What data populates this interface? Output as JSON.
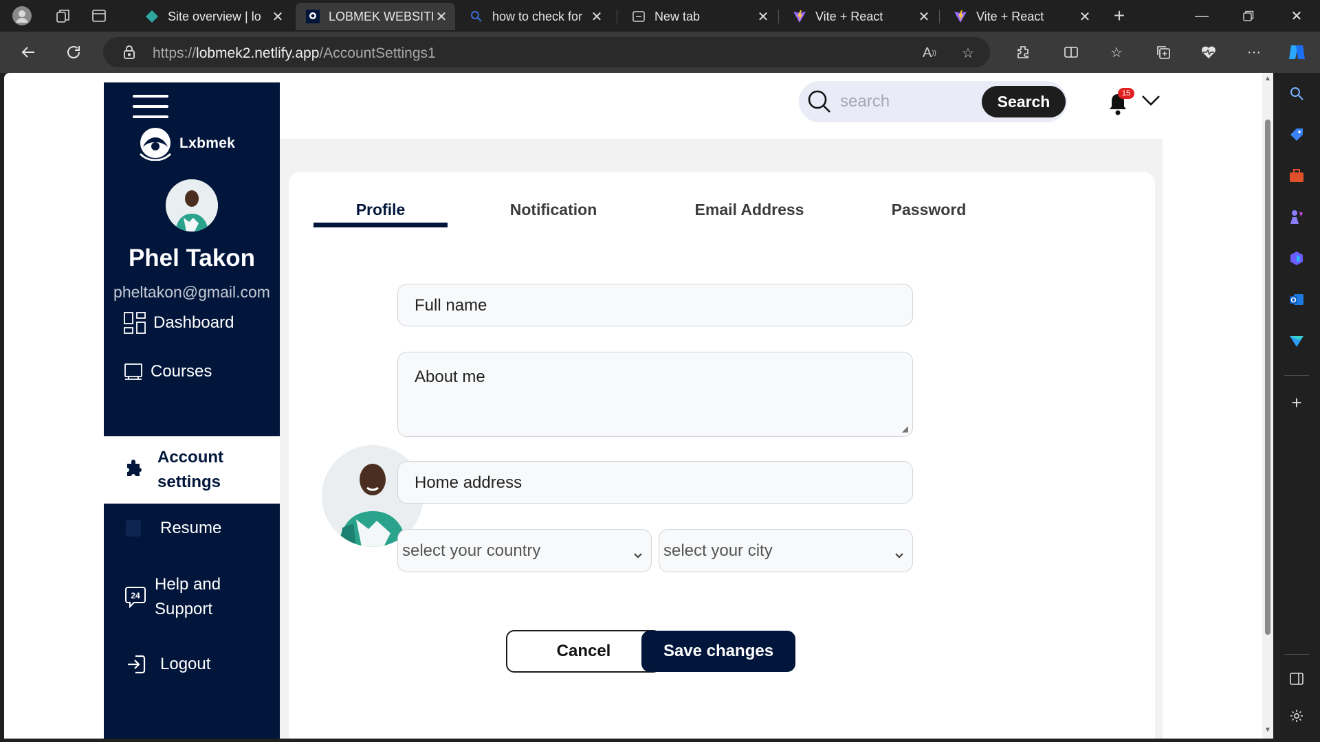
{
  "browser": {
    "tabs": [
      {
        "title": "Site overview | lo",
        "icon": "netlify-icon",
        "active": false
      },
      {
        "title": "LOBMEK WEBSITE",
        "icon": "lobmek-favicon",
        "active": true
      },
      {
        "title": "how to check for",
        "icon": "search-favicon",
        "active": false
      },
      {
        "title": "New tab",
        "icon": "new-tab-favicon",
        "active": false
      },
      {
        "title": "Vite + React",
        "icon": "vite-favicon",
        "active": false
      },
      {
        "title": "Vite + React",
        "icon": "vite-favicon",
        "active": false
      }
    ],
    "url_prefix": "https://",
    "url_host": "lobmek2.netlify.app",
    "url_path": "/AccountSettings1"
  },
  "sidebar": {
    "logo_text": "Lxbmek",
    "user_name": "Phel Takon",
    "user_email": "pheltakon@gmail.com",
    "items": [
      {
        "label": "Dashboard",
        "icon": "dashboard-icon"
      },
      {
        "label": "Courses",
        "icon": "courses-icon"
      },
      {
        "label": "Account settings",
        "icon": "puzzle-icon",
        "active": true
      },
      {
        "label": "Resume",
        "icon": "resume-icon"
      },
      {
        "label": "Help and Support",
        "icon": "support-24-icon"
      },
      {
        "label": "Logout",
        "icon": "logout-icon"
      }
    ]
  },
  "header": {
    "search_placeholder": "search",
    "search_button": "Search",
    "notification_count": "15"
  },
  "settings": {
    "tabs": [
      "Profile",
      "Notification",
      "Email Address",
      "Password"
    ],
    "active_tab": "Profile",
    "full_name_placeholder": "Full name",
    "about_placeholder": "About me",
    "address_placeholder": "Home address",
    "country_select": "select your country",
    "city_select": "select your city",
    "cancel_label": "Cancel",
    "save_label": "Save changes"
  },
  "colors": {
    "navy": "#02163b",
    "badge": "#e02020",
    "search_bg": "#e9ecf7"
  }
}
